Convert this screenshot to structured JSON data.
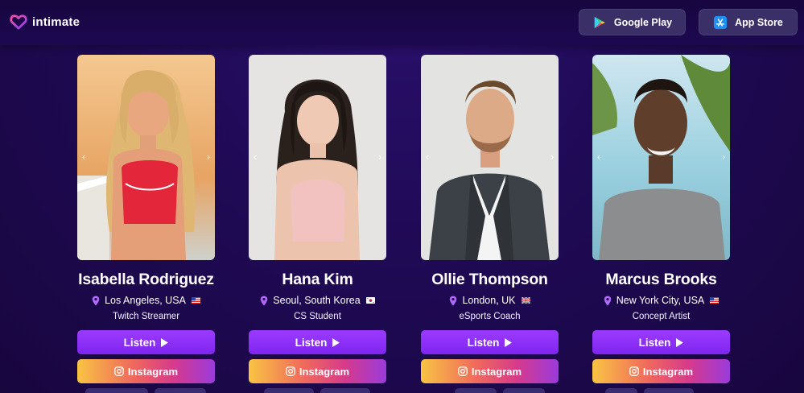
{
  "brand": {
    "name": "intimate",
    "logo_icon": "heart-logo-icon",
    "accent": "#8b3cf7"
  },
  "header": {
    "google_play_label": "Google Play",
    "app_store_label": "App Store"
  },
  "profiles": [
    {
      "name": "Isabella Rodriguez",
      "location": "Los Angeles, USA",
      "flag": "us-flag-icon",
      "role": "Twitch Streamer",
      "listen_label": "Listen",
      "instagram_label": "Instagram",
      "photo_icon": "portrait-photo-beach-woman-red-top"
    },
    {
      "name": "Hana Kim",
      "location": "Seoul, South Korea",
      "flag": "kr-flag-icon",
      "role": "CS Student",
      "listen_label": "Listen",
      "instagram_label": "Instagram",
      "photo_icon": "portrait-photo-woman-pink-top"
    },
    {
      "name": "Ollie Thompson",
      "location": "London, UK",
      "flag": "uk-flag-icon",
      "role": "eSports Coach",
      "listen_label": "Listen",
      "instagram_label": "Instagram",
      "photo_icon": "portrait-photo-man-suit"
    },
    {
      "name": "Marcus Brooks",
      "location": "New York City, USA",
      "flag": "us-flag-icon",
      "role": "Concept Artist",
      "listen_label": "Listen",
      "instagram_label": "Instagram",
      "photo_icon": "portrait-photo-man-grey-shirt-beach"
    }
  ],
  "colors": {
    "background": "#1f0a55",
    "listen_button": "#8a2ef5",
    "instagram_gradient": [
      "#f9c443",
      "#f06a5c",
      "#d63a8b",
      "#9a3bdc"
    ],
    "store_button": "#3a2f66"
  }
}
